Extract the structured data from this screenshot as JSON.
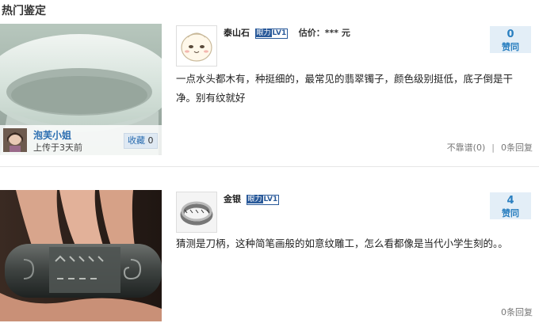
{
  "section_title": "热门鉴定",
  "items": [
    {
      "owner": {
        "name": "泡芙小姐",
        "uploaded": "上传于3天前"
      },
      "favorite": {
        "label": "收藏",
        "count": "0"
      },
      "user": {
        "name": "泰山石",
        "badge_a": "眼力",
        "badge_b": "LV1",
        "estimate": "估价：*** 元"
      },
      "votes": {
        "count": "0",
        "label": "赞同"
      },
      "comment": "一点水头都木有，种挺细的，最常见的翡翠镯子，颜色级别挺低，底子倒是干净。别有纹就好",
      "footer": {
        "report": "不靠谱(0)",
        "sep": "|",
        "replies": "0条回复"
      }
    },
    {
      "user": {
        "name": "金银",
        "badge_a": "眼力",
        "badge_b": "LV1"
      },
      "votes": {
        "count": "4",
        "label": "赞同"
      },
      "comment": "猜测是刀柄，这种简笔画般的如意纹雕工，怎么看都像是当代小学生刻的。。",
      "footer": {
        "replies": "0条回复"
      }
    }
  ],
  "colors": {
    "link": "#2a6db0",
    "vote_bg": "#e3eef7",
    "vote_text": "#2a7fc0",
    "badge": "#2a5a9a"
  }
}
